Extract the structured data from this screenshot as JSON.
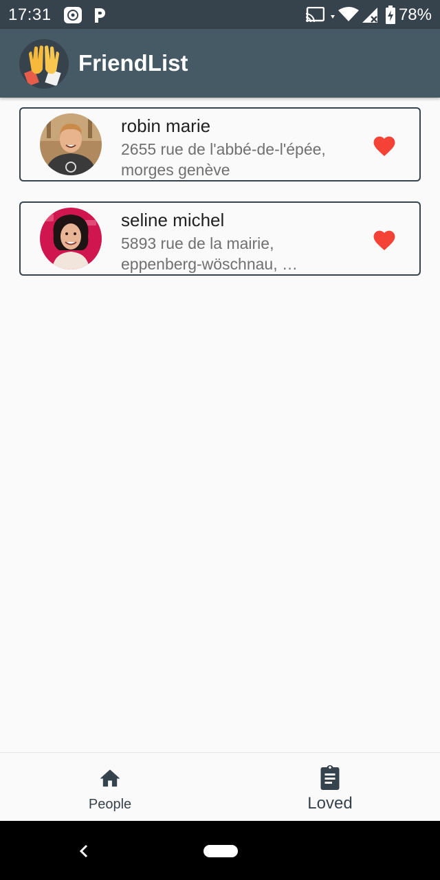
{
  "status": {
    "time": "17:31",
    "battery": "78%",
    "left_icons": [
      "photo-icon",
      "parking-icon"
    ],
    "right_icons": [
      "cast-icon",
      "wifi-icon",
      "signal-icon",
      "battery-icon"
    ]
  },
  "app": {
    "title": "FriendList",
    "logo_icon": "high-five-hands-icon",
    "bar_color": "#465a66"
  },
  "people": [
    {
      "name": "robin marie",
      "address": "2655 rue de l'abbé-de-l'épée, morges genève",
      "loved": true
    },
    {
      "name": "seline michel",
      "address": "5893 rue de la mairie, eppenberg-wöschnau, …",
      "loved": true
    }
  ],
  "colors": {
    "heart": "#f44336",
    "accent": "#36424c"
  },
  "bottom_nav": {
    "items": [
      {
        "label": "People",
        "icon": "home-icon"
      },
      {
        "label": "Loved",
        "icon": "clipboard-icon"
      }
    ]
  }
}
